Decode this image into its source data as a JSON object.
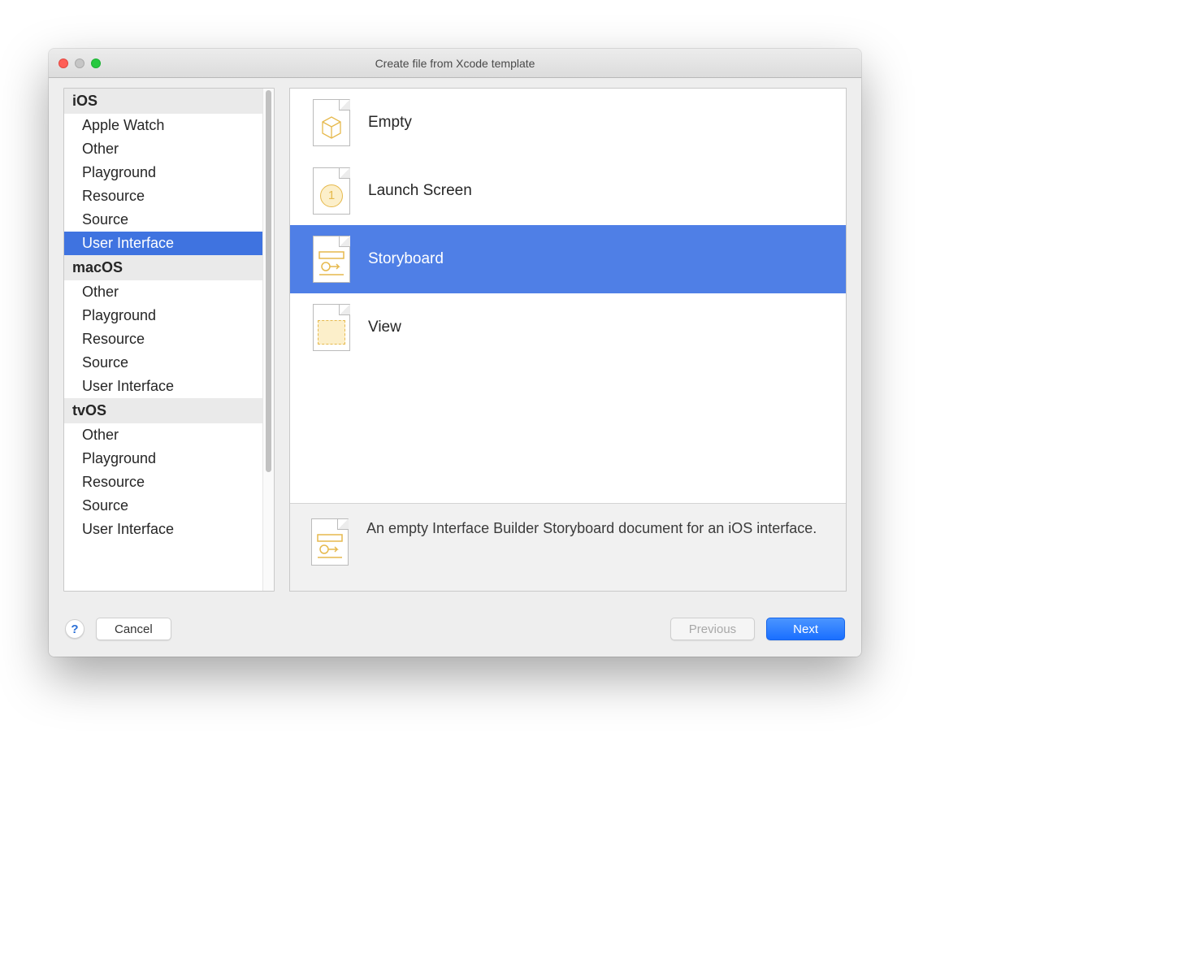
{
  "window": {
    "title": "Create file from Xcode template"
  },
  "sidebar": {
    "groups": [
      {
        "name": "iOS",
        "items": [
          "Apple Watch",
          "Other",
          "Playground",
          "Resource",
          "Source",
          "User Interface"
        ],
        "selected": "User Interface"
      },
      {
        "name": "macOS",
        "items": [
          "Other",
          "Playground",
          "Resource",
          "Source",
          "User Interface"
        ]
      },
      {
        "name": "tvOS",
        "items": [
          "Other",
          "Playground",
          "Resource",
          "Source",
          "User Interface"
        ]
      }
    ]
  },
  "templates": [
    {
      "id": "empty",
      "label": "Empty",
      "icon": "cube-icon"
    },
    {
      "id": "launch-screen",
      "label": "Launch Screen",
      "icon": "launch-icon"
    },
    {
      "id": "storyboard",
      "label": "Storyboard",
      "icon": "storyboard-icon",
      "selected": true
    },
    {
      "id": "view",
      "label": "View",
      "icon": "view-icon"
    }
  ],
  "description": {
    "text": "An empty Interface Builder Storyboard document for an iOS interface.",
    "icon": "storyboard-icon"
  },
  "footer": {
    "help": "?",
    "cancel": "Cancel",
    "previous": "Previous",
    "next": "Next"
  }
}
